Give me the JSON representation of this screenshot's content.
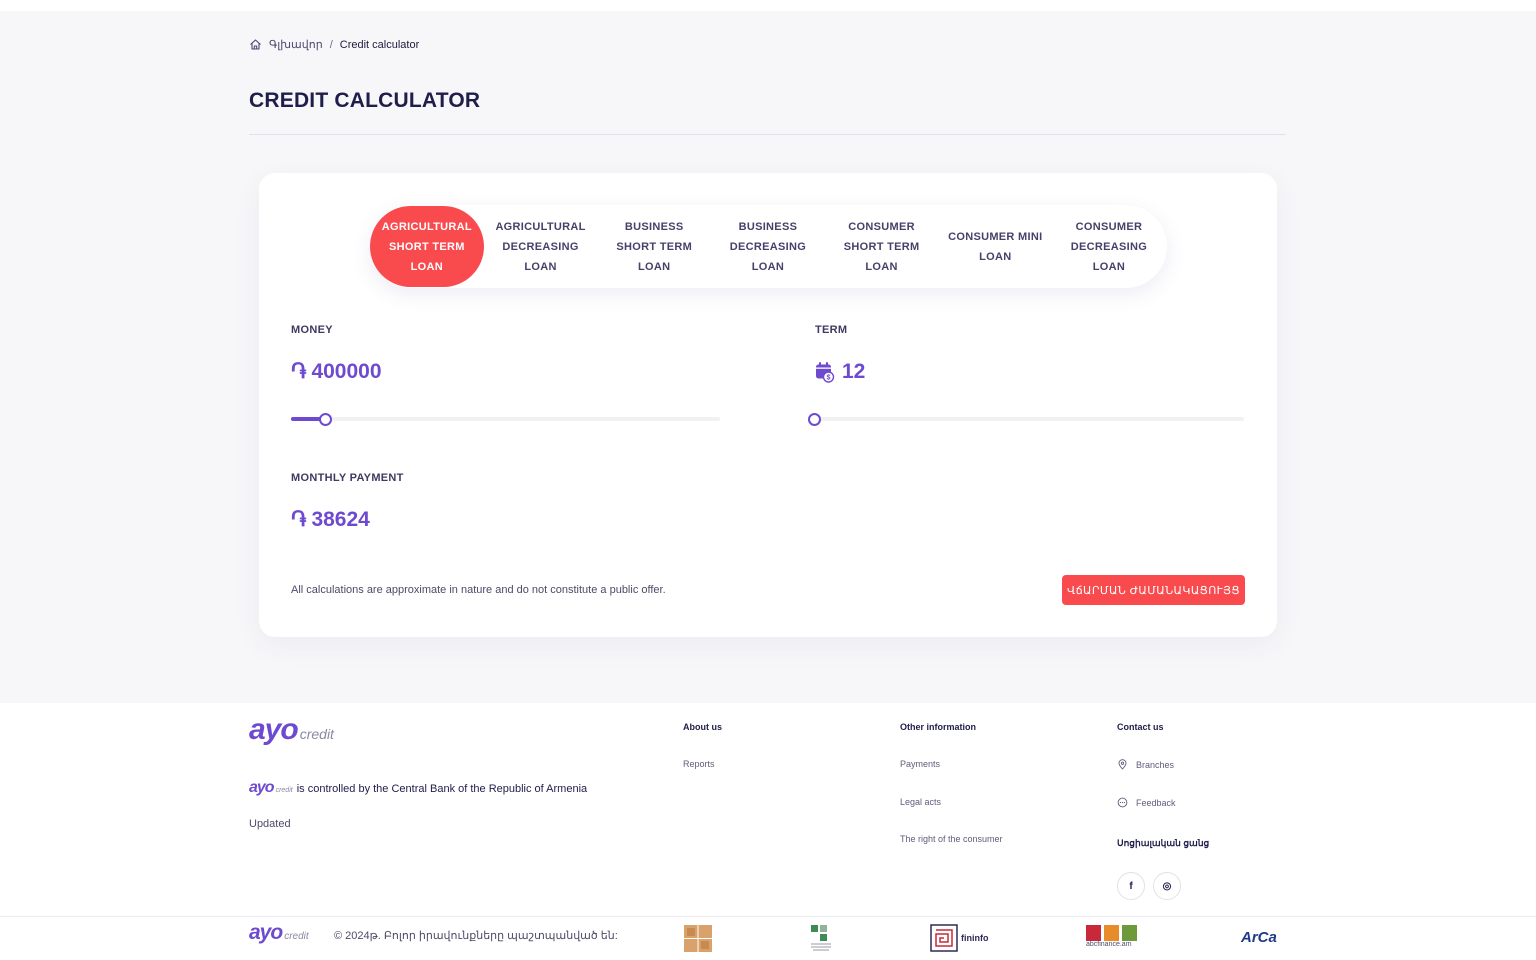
{
  "breadcrumb": {
    "home": "Գլխավոր",
    "separator": "/",
    "current": "Credit calculator"
  },
  "page_title": "CREDIT CALCULATOR",
  "tabs": [
    {
      "label": "AGRICULTURAL SHORT TERM LOAN",
      "active": true
    },
    {
      "label": "AGRICULTURAL DECREASING LOAN",
      "active": false
    },
    {
      "label": "BUSINESS SHORT TERM LOAN",
      "active": false
    },
    {
      "label": "BUSINESS DECREASING LOAN",
      "active": false
    },
    {
      "label": "CONSUMER SHORT TERM LOAN",
      "active": false
    },
    {
      "label": "CONSUMER MINI LOAN",
      "active": false
    },
    {
      "label": "CONSUMER DECREASING LOAN",
      "active": false
    }
  ],
  "money": {
    "label": "MONEY",
    "currency_symbol": "֏",
    "value": "400000",
    "slider_fraction": 0.08
  },
  "term": {
    "label": "TERM",
    "icon": "calendar-money-icon",
    "value": "12",
    "slider_fraction": 0.0
  },
  "monthly_payment": {
    "label": "MONTHLY PAYMENT",
    "currency_symbol": "֏",
    "value": "38624"
  },
  "disclaimer": "All calculations are approximate in nature and do not constitute a public offer.",
  "apply_button": "ՎճԱՐՄԱՆ ԺԱՄԱՆԱԿԱՑՈՒՅՑ",
  "footer": {
    "logo": {
      "mark": "ayo",
      "sub": "credit"
    },
    "controlled_text": "is controlled by the Central Bank of the Republic of Armenia",
    "updated": "Updated",
    "about": {
      "title": "About us",
      "links": [
        "Reports"
      ]
    },
    "other": {
      "title": "Other information",
      "links": [
        "Payments",
        "Legal acts",
        "The right of the consumer"
      ]
    },
    "contact": {
      "title": "Contact us",
      "links": [
        "Branches",
        "Feedback"
      ]
    },
    "social_title": "Սոցիալական ցանց",
    "social": [
      "f",
      "◎"
    ],
    "copyright": "© 2024թ. Բոլոր իրավունքները պաշտպանված են:",
    "partners": [
      "fininfo",
      "abcfinance.am",
      "ArCa"
    ]
  },
  "colors": {
    "accent": "#6e4ad0",
    "brand_red": "#f94a4e",
    "title": "#1f1d4a"
  }
}
